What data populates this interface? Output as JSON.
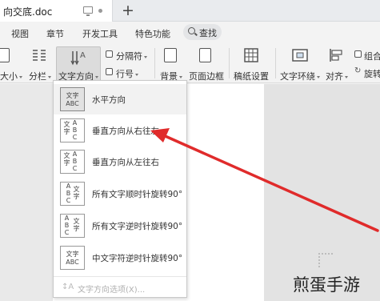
{
  "tab": {
    "title": "向交底.doc"
  },
  "menubar": {
    "items": [
      "视图",
      "章节",
      "开发工具",
      "特色功能"
    ],
    "search_label": "查找"
  },
  "ribbon": {
    "size_label": "大小",
    "columns_label": "分栏",
    "text_direction_label": "文字方向",
    "separator_label": "分隔符",
    "line_number_label": "行号",
    "background_label": "背景",
    "page_border_label": "页面边框",
    "manuscript_label": "稿纸设置",
    "text_wrap_label": "文字环绕",
    "align_label": "对齐",
    "group_label": "组合",
    "rotate_label": "旋转"
  },
  "dropdown": {
    "items": [
      {
        "label": "水平方向",
        "thumb": "文字ABC"
      },
      {
        "label": "垂直方向从右往左",
        "thumb": "ABC文字"
      },
      {
        "label": "垂直方向从左往右",
        "thumb": "文字ABC"
      },
      {
        "label": "所有文字顺时针旋转90°",
        "thumb": "ABC文字"
      },
      {
        "label": "所有文字逆时针旋转90°",
        "thumb": "ABC文字"
      },
      {
        "label": "中文字符逆时针旋转90°",
        "thumb": "文字ABC"
      }
    ],
    "footer_label": "文字方向选项(X)..."
  },
  "annotation": {
    "arrow_color": "#e02b2b"
  },
  "watermark": "煎蛋手游"
}
